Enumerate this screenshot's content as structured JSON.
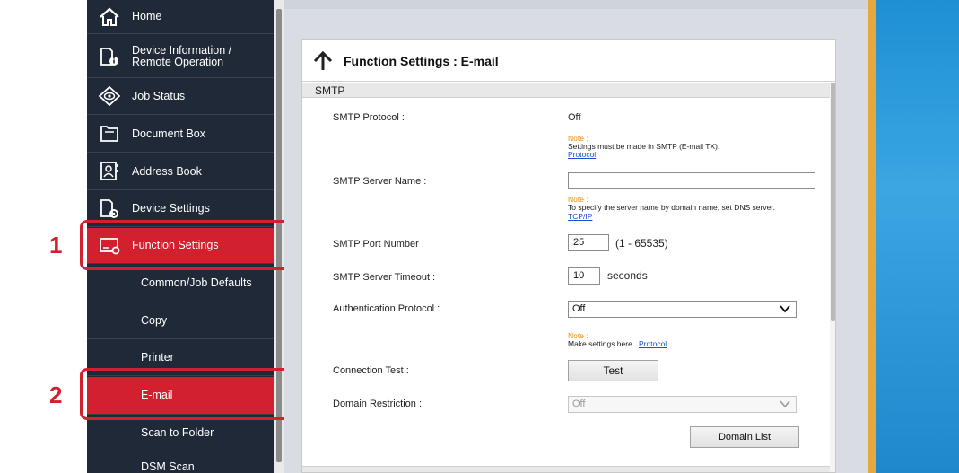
{
  "sidebar": {
    "items": [
      {
        "label": "Home",
        "icon": "home-icon"
      },
      {
        "label": "Device Information /\nRemote Operation",
        "icon": "device-info-icon"
      },
      {
        "label": "Job Status",
        "icon": "job-status-icon"
      },
      {
        "label": "Document Box",
        "icon": "document-box-icon"
      },
      {
        "label": "Address Book",
        "icon": "address-book-icon"
      },
      {
        "label": "Device Settings",
        "icon": "device-settings-icon"
      },
      {
        "label": "Function Settings",
        "icon": "function-settings-icon"
      }
    ],
    "subitems": [
      {
        "label": "Common/Job Defaults"
      },
      {
        "label": "Copy"
      },
      {
        "label": "Printer"
      },
      {
        "label": "E-mail"
      },
      {
        "label": "Scan to Folder"
      },
      {
        "label": "DSM Scan"
      }
    ],
    "active_item": "Function Settings",
    "active_subitem": "E-mail"
  },
  "callouts": [
    "1",
    "2"
  ],
  "panel": {
    "title": "Function Settings : E-mail",
    "section": "SMTP"
  },
  "form": {
    "smtp_protocol": {
      "label": "SMTP Protocol :",
      "value": "Off",
      "note_title": "Note :",
      "note": "Settings must be made in SMTP (E-mail TX).",
      "note_link": "Protocol"
    },
    "smtp_server_name": {
      "label": "SMTP Server Name :",
      "value": "",
      "note_title": "Note :",
      "note": "To specify the server name by domain name, set DNS server.",
      "note_link": "TCP/IP"
    },
    "smtp_port": {
      "label": "SMTP Port Number :",
      "value": "25",
      "range": "(1 - 65535)"
    },
    "smtp_timeout": {
      "label": "SMTP Server Timeout :",
      "value": "10",
      "unit": "seconds"
    },
    "auth_protocol": {
      "label": "Authentication Protocol :",
      "value": "Off",
      "note_title": "Note :",
      "note": "Make settings here.",
      "note_link": "Protocol"
    },
    "connection_test": {
      "label": "Connection Test :",
      "button": "Test"
    },
    "domain_restriction": {
      "label": "Domain Restriction :",
      "value": "Off",
      "button": "Domain List"
    }
  },
  "colors": {
    "sidebar_bg": "#1f2937",
    "active": "#d3202e",
    "note_orange": "#f08a00",
    "link_blue": "#1a4fd6"
  }
}
